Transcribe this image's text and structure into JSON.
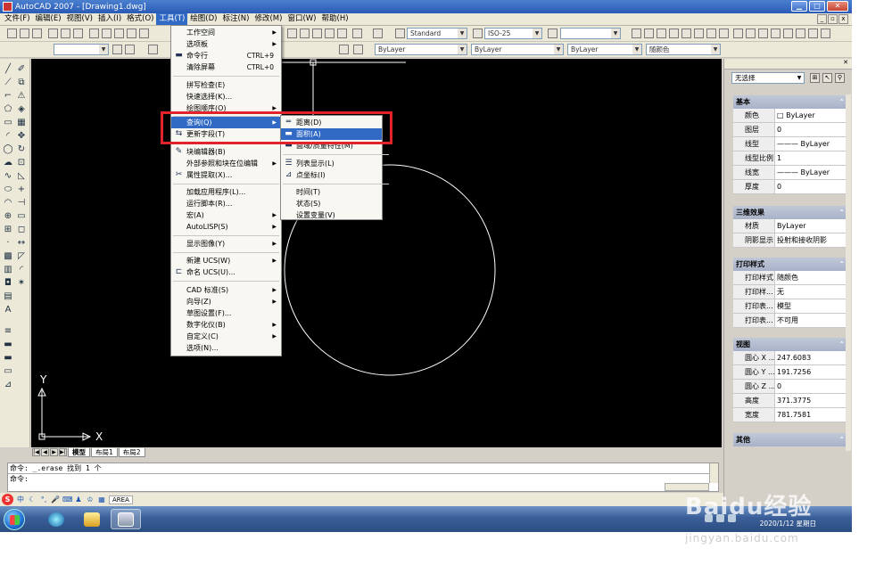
{
  "window": {
    "title": "AutoCAD 2007 - [Drawing1.dwg]"
  },
  "menubar": [
    {
      "label": "文件(F)"
    },
    {
      "label": "编辑(E)"
    },
    {
      "label": "视图(V)"
    },
    {
      "label": "插入(I)"
    },
    {
      "label": "格式(O)"
    },
    {
      "label": "工具(T)"
    },
    {
      "label": "绘图(D)"
    },
    {
      "label": "标注(N)"
    },
    {
      "label": "修改(M)"
    },
    {
      "label": "窗口(W)"
    },
    {
      "label": "帮助(H)"
    }
  ],
  "toolbar": {
    "text_style": "Standard",
    "dim_style": "ISO-25",
    "layer_color": "ByLayer",
    "layer_linetype": "ByLayer",
    "layer_lineweight": "ByLayer",
    "plot_style": "随颜色"
  },
  "tools_menu": {
    "items": [
      {
        "label": "工作空间",
        "shortcut": "",
        "submenu": true
      },
      {
        "label": "选项板",
        "shortcut": "",
        "submenu": true
      },
      {
        "label": "命令行",
        "shortcut": "CTRL+9",
        "submenu": false
      },
      {
        "label": "清除屏幕",
        "shortcut": "CTRL+0",
        "submenu": false
      },
      {
        "label": "拼写检查(E)",
        "shortcut": "",
        "submenu": false
      },
      {
        "label": "快速选择(K)...",
        "shortcut": "",
        "submenu": false
      },
      {
        "label": "绘图顺序(O)",
        "shortcut": "",
        "submenu": true
      },
      {
        "label": "查询(Q)",
        "shortcut": "",
        "submenu": true
      },
      {
        "label": "更新字段(T)",
        "shortcut": "",
        "submenu": false
      },
      {
        "label": "块编辑器(B)",
        "shortcut": "",
        "submenu": false
      },
      {
        "label": "外部参照和块在位编辑",
        "shortcut": "",
        "submenu": true
      },
      {
        "label": "属性提取(X)...",
        "shortcut": "",
        "submenu": false
      },
      {
        "label": "加载应用程序(L)...",
        "shortcut": "",
        "submenu": false
      },
      {
        "label": "运行脚本(R)...",
        "shortcut": "",
        "submenu": false
      },
      {
        "label": "宏(A)",
        "shortcut": "",
        "submenu": true
      },
      {
        "label": "AutoLISP(S)",
        "shortcut": "",
        "submenu": true
      },
      {
        "label": "显示图像(Y)",
        "shortcut": "",
        "submenu": true
      },
      {
        "label": "新建 UCS(W)",
        "shortcut": "",
        "submenu": true
      },
      {
        "label": "命名 UCS(U)...",
        "shortcut": "",
        "submenu": false
      },
      {
        "label": "CAD 标准(S)",
        "shortcut": "",
        "submenu": true
      },
      {
        "label": "向导(Z)",
        "shortcut": "",
        "submenu": true
      },
      {
        "label": "草图设置(F)...",
        "shortcut": "",
        "submenu": false
      },
      {
        "label": "数字化仪(B)",
        "shortcut": "",
        "submenu": true
      },
      {
        "label": "自定义(C)",
        "shortcut": "",
        "submenu": true
      },
      {
        "label": "选项(N)...",
        "shortcut": "",
        "submenu": false
      }
    ]
  },
  "inquiry_menu": {
    "items": [
      {
        "label": "距离(D)"
      },
      {
        "label": "面积(A)"
      },
      {
        "label": "面域/质量特性(M)"
      },
      {
        "label": "列表显示(L)"
      },
      {
        "label": "点坐标(I)"
      },
      {
        "label": "时间(T)"
      },
      {
        "label": "状态(S)"
      },
      {
        "label": "设置变量(V)"
      }
    ]
  },
  "layout_tabs": [
    "模型",
    "布局1",
    "布局2"
  ],
  "command": {
    "history": "命令: _.erase 找到 1 个",
    "prompt": "命令:"
  },
  "ime": {
    "field": "AREA"
  },
  "ucs": {
    "x_label": "X",
    "y_label": "Y"
  },
  "properties": {
    "selection": "无选择",
    "sections": [
      {
        "title": "基本",
        "rows": [
          {
            "k": "颜色",
            "v": "□ ByLayer"
          },
          {
            "k": "图层",
            "v": "0"
          },
          {
            "k": "线型",
            "v": "——— ByLayer"
          },
          {
            "k": "线型比例",
            "v": "1"
          },
          {
            "k": "线宽",
            "v": "——— ByLayer"
          },
          {
            "k": "厚度",
            "v": "0"
          }
        ]
      },
      {
        "title": "三维效果",
        "rows": [
          {
            "k": "材质",
            "v": "ByLayer"
          },
          {
            "k": "阴影显示",
            "v": "投射和接收阴影"
          }
        ]
      },
      {
        "title": "打印样式",
        "rows": [
          {
            "k": "打印样式",
            "v": "随颜色"
          },
          {
            "k": "打印样...",
            "v": "无"
          },
          {
            "k": "打印表...",
            "v": "模型"
          },
          {
            "k": "打印表...",
            "v": "不可用"
          }
        ]
      },
      {
        "title": "视图",
        "rows": [
          {
            "k": "圆心 X ...",
            "v": "247.6083"
          },
          {
            "k": "圆心 Y ...",
            "v": "191.7256"
          },
          {
            "k": "圆心 Z ...",
            "v": "0"
          },
          {
            "k": "高度",
            "v": "371.3775"
          },
          {
            "k": "宽度",
            "v": "781.7581"
          }
        ]
      },
      {
        "title": "其他",
        "rows": []
      }
    ]
  },
  "taskbar": {
    "date": "2020/1/12 星期日"
  },
  "watermark": {
    "text": "Baidu经验",
    "url": "jingyan.baidu.com"
  },
  "colors": {
    "highlight": "#316ac5",
    "annotation": "#e0242a",
    "canvas": "#000000"
  }
}
